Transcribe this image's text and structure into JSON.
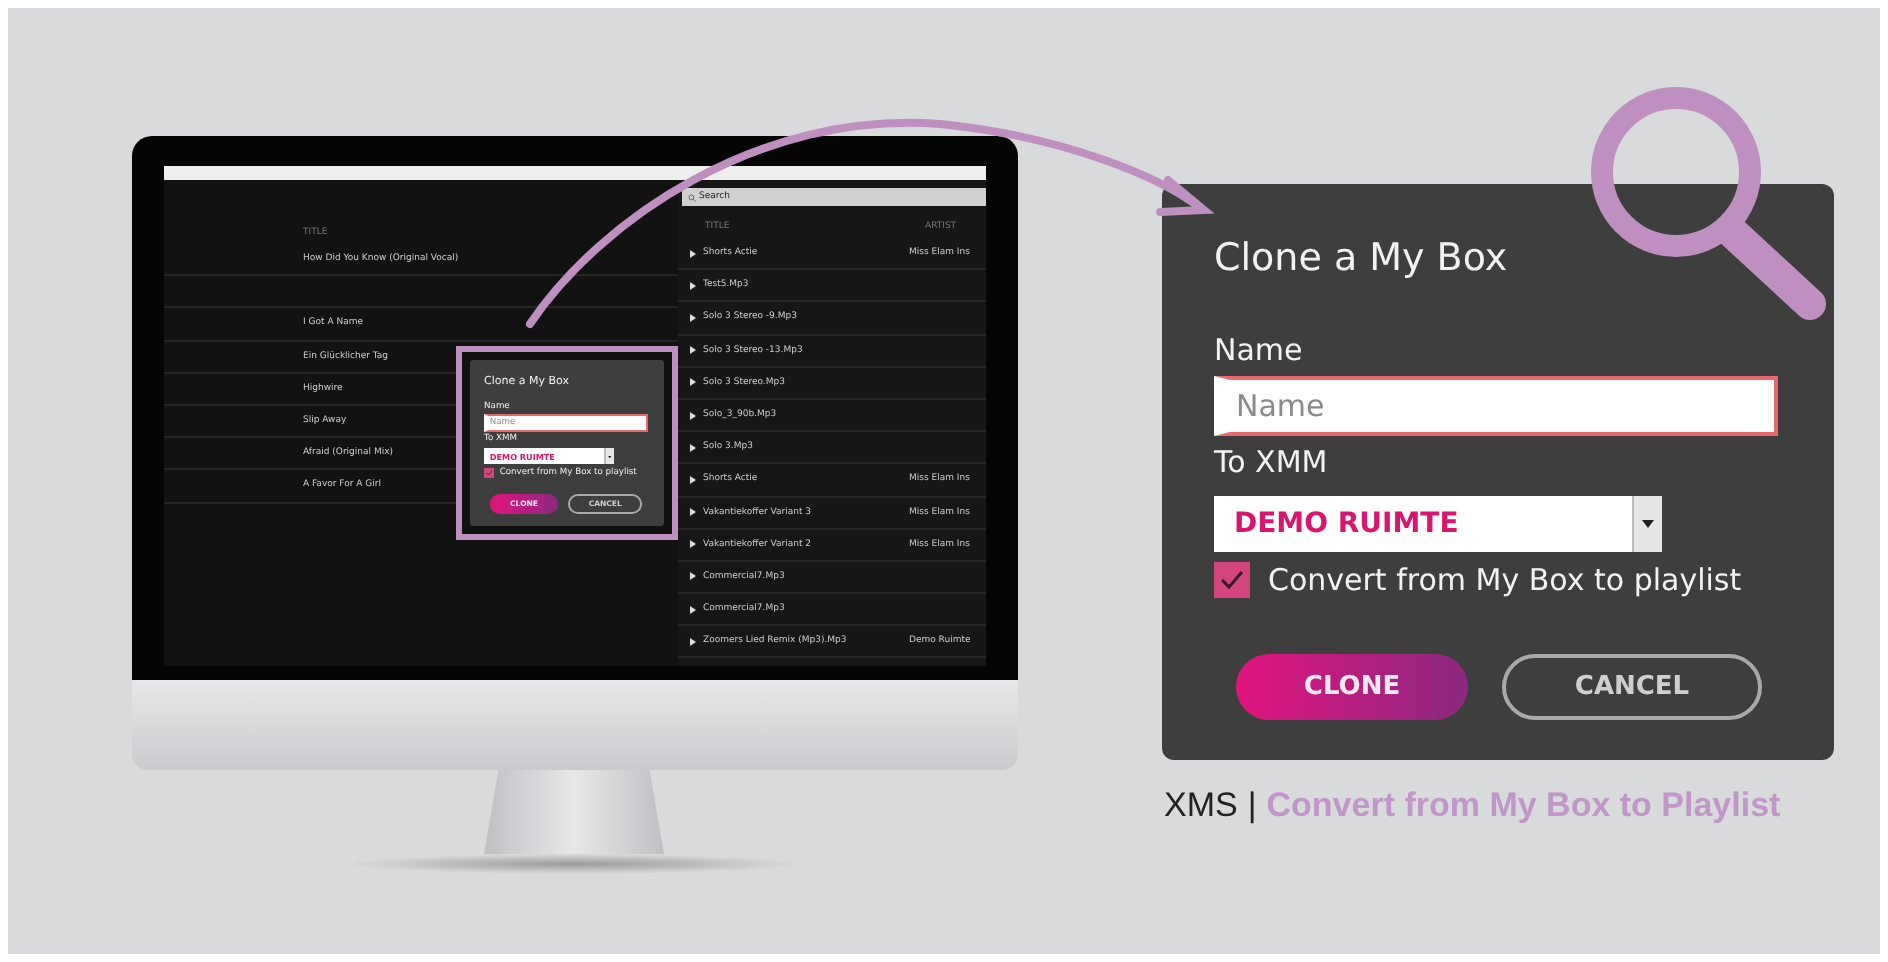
{
  "monitor": {
    "library": {
      "header": "TITLE",
      "rows": [
        "How Did You Know (Original Vocal)",
        "",
        "I Got A Name",
        "Ein Glücklicher Tag",
        "Highwire",
        "Slip Away",
        "Afraid (Original Mix)",
        "A Favor For A Girl"
      ]
    },
    "playlist": {
      "search": {
        "placeholder": "Search"
      },
      "columns": [
        "TITLE",
        "ARTIST"
      ],
      "rows": [
        {
          "title": "Shorts Actie",
          "artist": "Miss Elam Ins"
        },
        {
          "title": "Test5.Mp3",
          "artist": ""
        },
        {
          "title": "Solo 3 Stereo -9.Mp3",
          "artist": ""
        },
        {
          "title": "Solo 3 Stereo -13.Mp3",
          "artist": ""
        },
        {
          "title": "Solo 3 Stereo.Mp3",
          "artist": ""
        },
        {
          "title": "Solo_3_90b.Mp3",
          "artist": ""
        },
        {
          "title": "Solo 3.Mp3",
          "artist": ""
        },
        {
          "title": "Shorts Actie",
          "artist": "Miss Elam Ins"
        },
        {
          "title": "Vakantiekoffer Variant 3",
          "artist": "Miss Elam Ins"
        },
        {
          "title": "Vakantiekoffer Variant 2",
          "artist": "Miss Elam Ins"
        },
        {
          "title": "Commercial7.Mp3",
          "artist": ""
        },
        {
          "title": "Commercial7.Mp3",
          "artist": ""
        },
        {
          "title": "Zoomers Lied Remix (Mp3).Mp3",
          "artist": "Demo Ruimte"
        }
      ]
    },
    "dialog": {
      "title": "Clone a My Box",
      "name_label": "Name",
      "name_placeholder": "Name",
      "target_label": "To XMM",
      "target_value": "DEMO RUIMTE",
      "convert_label": "Convert from My Box to playlist",
      "convert_checked": true,
      "buttons": [
        "CLONE",
        "CANCEL"
      ]
    }
  },
  "dialog": {
    "title": "Clone a My Box",
    "name_label": "Name",
    "name_placeholder": "Name",
    "target_label": "To XMM",
    "target_value": "DEMO RUIMTE",
    "convert_label": "Convert from My Box to playlist",
    "convert_checked": true,
    "buttons": [
      "CLONE",
      "CANCEL"
    ]
  },
  "caption": {
    "brand": "XMS",
    "separator": "|",
    "text": "Convert from My Box to Playlist"
  }
}
